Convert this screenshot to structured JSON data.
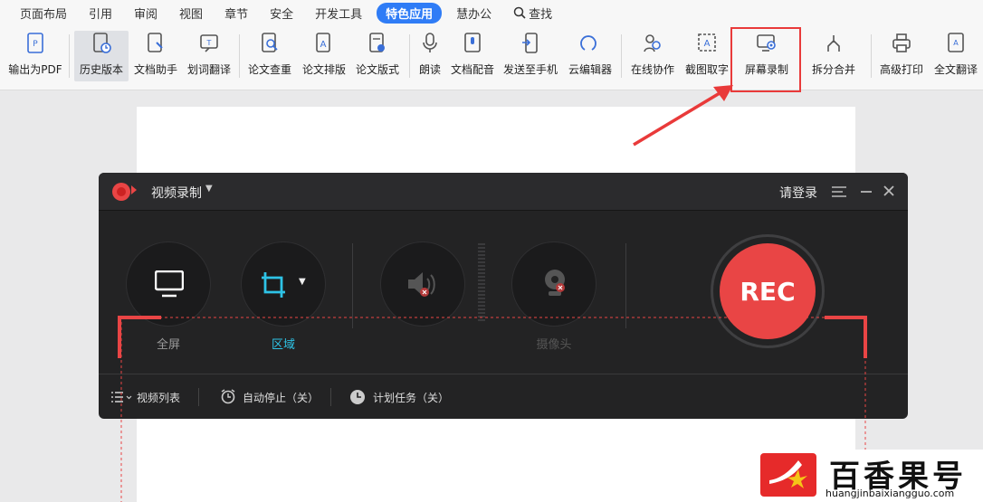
{
  "menu": {
    "tabs": [
      "页面布局",
      "引用",
      "审阅",
      "视图",
      "章节",
      "安全",
      "开发工具",
      "特色应用",
      "慧办公"
    ],
    "active_tab": "特色应用",
    "search_label": "查找"
  },
  "ribbon": {
    "items": [
      {
        "label": "输出为PDF",
        "icon": "pdf-export-icon"
      },
      {
        "label": "历史版本",
        "icon": "history-icon"
      },
      {
        "label": "文档助手",
        "icon": "doc-assistant-icon"
      },
      {
        "label": "划词翻译",
        "icon": "translate-icon"
      },
      {
        "label": "论文查重",
        "icon": "plagiarism-check-icon"
      },
      {
        "label": "论文排版",
        "icon": "paper-layout-icon"
      },
      {
        "label": "论文版式",
        "icon": "paper-format-icon"
      },
      {
        "label": "朗读",
        "icon": "read-aloud-icon"
      },
      {
        "label": "文档配音",
        "icon": "voiceover-icon"
      },
      {
        "label": "发送至手机",
        "icon": "send-phone-icon"
      },
      {
        "label": "云编辑器",
        "icon": "cloud-editor-icon"
      },
      {
        "label": "在线协作",
        "icon": "collab-icon"
      },
      {
        "label": "截图取字",
        "icon": "ocr-icon"
      },
      {
        "label": "屏幕录制",
        "icon": "screen-record-icon"
      },
      {
        "label": "拆分合并",
        "icon": "split-merge-icon"
      },
      {
        "label": "高级打印",
        "icon": "print-icon"
      },
      {
        "label": "全文翻译",
        "icon": "full-translate-icon"
      }
    ]
  },
  "recorder": {
    "title": "视频录制",
    "login": "请登录",
    "modes": {
      "fullscreen": "全屏",
      "region": "区域",
      "camera": "摄像头"
    },
    "rec_label": "REC",
    "bottom": {
      "video_list": "视频列表",
      "auto_stop": "自动停止（关）",
      "schedule": "计划任务（关）"
    }
  },
  "watermark": {
    "brand_text": "百香果号",
    "url": "huangjinbaixiangguo.com"
  },
  "colors": {
    "accent": "#2f7cf6",
    "record_red": "#e94545",
    "highlight": "#e93a3a",
    "region_cyan": "#2ec3e6"
  }
}
